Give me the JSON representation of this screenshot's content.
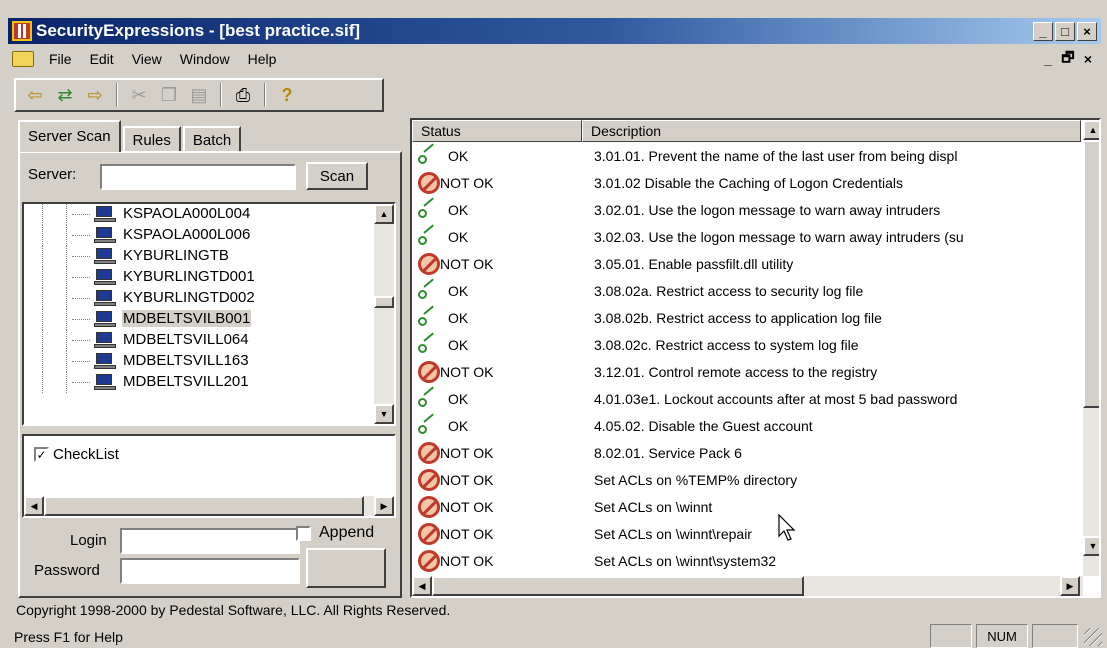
{
  "window": {
    "title": "SecurityExpressions - [best practice.sif]",
    "buttons": [
      "_",
      "□",
      "×"
    ],
    "doc_buttons": [
      "_",
      "🗗",
      "×"
    ]
  },
  "menu": [
    "File",
    "Edit",
    "View",
    "Window",
    "Help"
  ],
  "toolbar": {
    "icons": [
      "back-icon",
      "compare-icon",
      "export-icon",
      "cut-icon",
      "copy-icon",
      "paste-icon",
      "print-icon",
      "help-icon"
    ]
  },
  "left": {
    "tabs": [
      "Server Scan",
      "Rules",
      "Batch"
    ],
    "server_label": "Server:",
    "server_value": "",
    "scan_label": "Scan",
    "tree_items": [
      {
        "label": "KSPAOLA000L004",
        "selected": false
      },
      {
        "label": "KSPAOLA000L006",
        "selected": false
      },
      {
        "label": "KYBURLINGTB",
        "selected": false
      },
      {
        "label": "KYBURLINGTD001",
        "selected": false
      },
      {
        "label": "KYBURLINGTD002",
        "selected": false
      },
      {
        "label": "MDBELTSVILB001",
        "selected": true
      },
      {
        "label": "MDBELTSVILL064",
        "selected": false
      },
      {
        "label": "MDBELTSVILL163",
        "selected": false
      },
      {
        "label": "MDBELTSVILL201",
        "selected": false
      }
    ],
    "checklist_label": "CheckList",
    "checklist_checked": true,
    "login_label": "Login",
    "login_value": "",
    "append_label": "Append",
    "append_checked": false,
    "password_label": "Password",
    "password_value": ""
  },
  "results": {
    "columns": [
      "Status",
      "Description"
    ],
    "rows": [
      {
        "status": "OK",
        "ok": true,
        "description": "3.01.01. Prevent the name of the last user from being displ"
      },
      {
        "status": "NOT OK",
        "ok": false,
        "description": "3.01.02 Disable the Caching of Logon Credentials"
      },
      {
        "status": "OK",
        "ok": true,
        "description": "3.02.01. Use the logon message to warn away intruders"
      },
      {
        "status": "OK",
        "ok": true,
        "description": "3.02.03. Use the logon message to warn away intruders (su"
      },
      {
        "status": "NOT OK",
        "ok": false,
        "description": "3.05.01. Enable passfilt.dll utility"
      },
      {
        "status": "OK",
        "ok": true,
        "description": "3.08.02a. Restrict access to security log file"
      },
      {
        "status": "OK",
        "ok": true,
        "description": "3.08.02b. Restrict access to application log file"
      },
      {
        "status": "OK",
        "ok": true,
        "description": "3.08.02c. Restrict access to system log file"
      },
      {
        "status": "NOT OK",
        "ok": false,
        "description": "3.12.01. Control remote access to the registry"
      },
      {
        "status": "OK",
        "ok": true,
        "description": "4.01.03e1. Lockout accounts after at most 5 bad password"
      },
      {
        "status": "OK",
        "ok": true,
        "description": "4.05.02. Disable the Guest account"
      },
      {
        "status": "NOT OK",
        "ok": false,
        "description": "8.02.01. Service Pack 6"
      },
      {
        "status": "NOT OK",
        "ok": false,
        "description": "Set ACLs on %TEMP% directory"
      },
      {
        "status": "NOT OK",
        "ok": false,
        "description": "Set ACLs on \\winnt"
      },
      {
        "status": "NOT OK",
        "ok": false,
        "description": "Set ACLs on \\winnt\\repair"
      },
      {
        "status": "NOT OK",
        "ok": false,
        "description": "Set ACLs on \\winnt\\system32"
      }
    ]
  },
  "statusbar": {
    "copyright": "Copyright 1998-2000 by Pedestal Software, LLC. All Rights Reserved.",
    "help": "Press F1 for Help",
    "num": "NUM"
  },
  "colors": {
    "title_start": "#0a246a",
    "title_end": "#a6caf0",
    "ok_green": "#2e8b2e",
    "not_ok_red": "#c0392b"
  }
}
